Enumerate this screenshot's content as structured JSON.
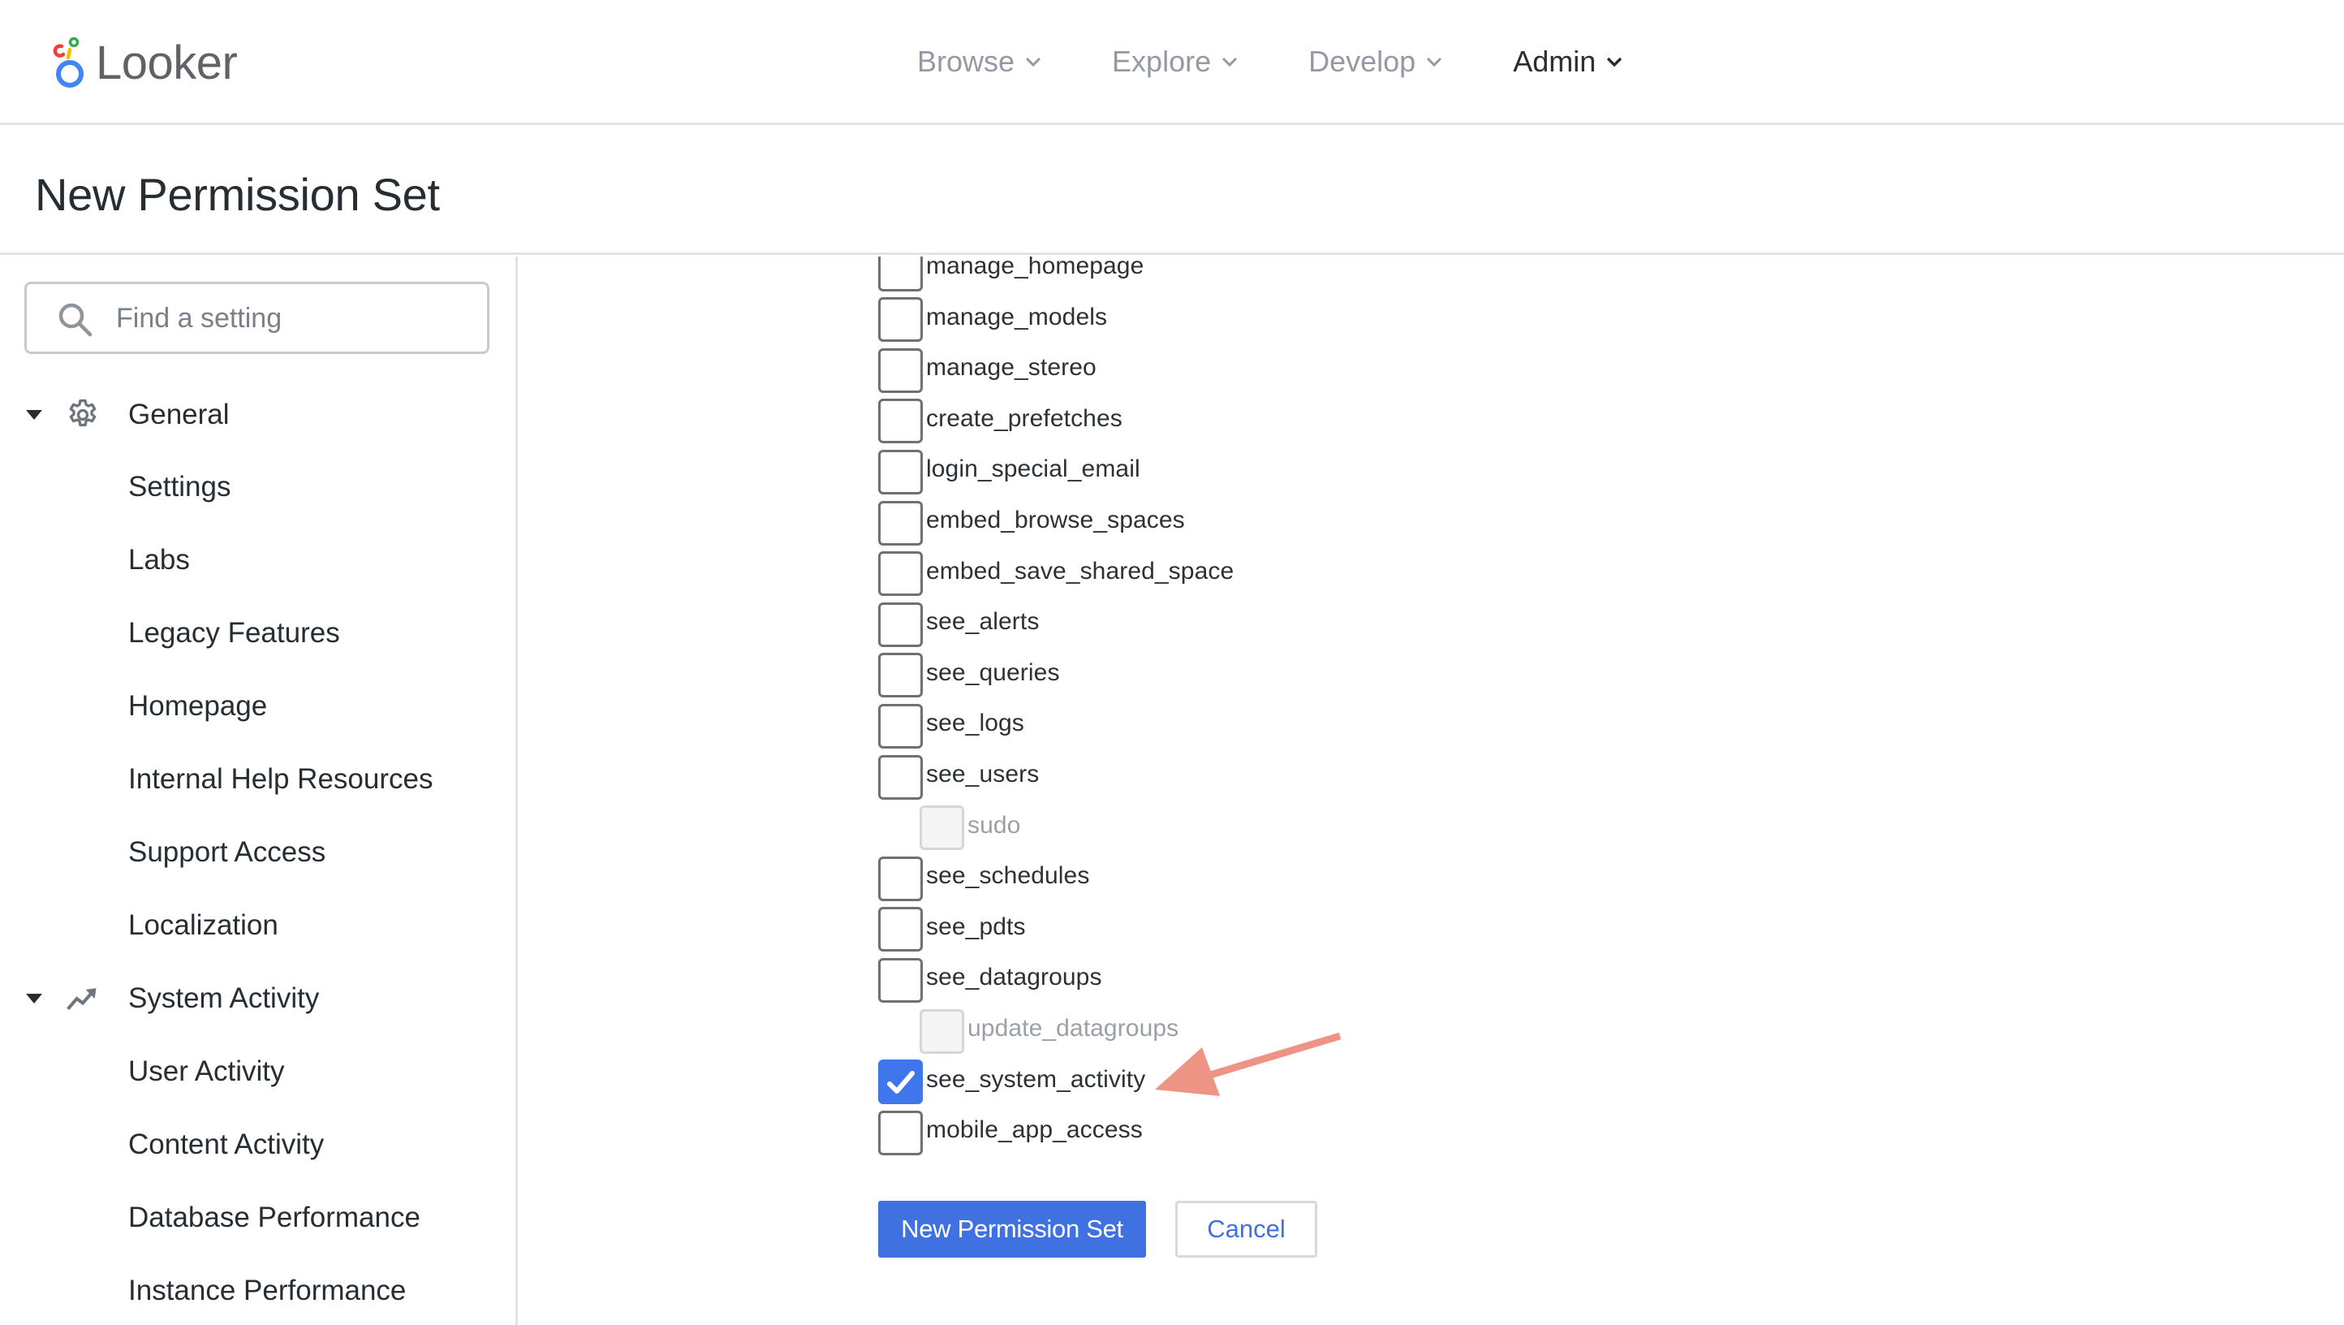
{
  "app": {
    "name": "Looker",
    "logo_colors": {
      "ring": "#4285f4",
      "red": "#ea4335",
      "yellow": "#fbbc04",
      "green": "#34a853"
    }
  },
  "topnav": {
    "items": [
      {
        "label": "Browse",
        "active": false
      },
      {
        "label": "Explore",
        "active": false
      },
      {
        "label": "Develop",
        "active": false
      },
      {
        "label": "Admin",
        "active": true
      }
    ]
  },
  "page": {
    "title": "New Permission Set"
  },
  "sidebar": {
    "search": {
      "placeholder": "Find a setting",
      "value": ""
    },
    "groups": [
      {
        "label": "General",
        "icon": "gear-icon",
        "expanded": true,
        "items": [
          "Settings",
          "Labs",
          "Legacy Features",
          "Homepage",
          "Internal Help Resources",
          "Support Access",
          "Localization"
        ]
      },
      {
        "label": "System Activity",
        "icon": "trending-up-icon",
        "expanded": true,
        "items": [
          "User Activity",
          "Content Activity",
          "Database Performance",
          "Instance Performance"
        ]
      }
    ]
  },
  "permissions": [
    {
      "name": "manage_homepage",
      "checked": false,
      "child": false,
      "disabled": false
    },
    {
      "name": "manage_models",
      "checked": false,
      "child": false,
      "disabled": false
    },
    {
      "name": "manage_stereo",
      "checked": false,
      "child": false,
      "disabled": false
    },
    {
      "name": "create_prefetches",
      "checked": false,
      "child": false,
      "disabled": false
    },
    {
      "name": "login_special_email",
      "checked": false,
      "child": false,
      "disabled": false
    },
    {
      "name": "embed_browse_spaces",
      "checked": false,
      "child": false,
      "disabled": false
    },
    {
      "name": "embed_save_shared_space",
      "checked": false,
      "child": false,
      "disabled": false
    },
    {
      "name": "see_alerts",
      "checked": false,
      "child": false,
      "disabled": false
    },
    {
      "name": "see_queries",
      "checked": false,
      "child": false,
      "disabled": false
    },
    {
      "name": "see_logs",
      "checked": false,
      "child": false,
      "disabled": false
    },
    {
      "name": "see_users",
      "checked": false,
      "child": false,
      "disabled": false
    },
    {
      "name": "sudo",
      "checked": false,
      "child": true,
      "disabled": true
    },
    {
      "name": "see_schedules",
      "checked": false,
      "child": false,
      "disabled": false
    },
    {
      "name": "see_pdts",
      "checked": false,
      "child": false,
      "disabled": false
    },
    {
      "name": "see_datagroups",
      "checked": false,
      "child": false,
      "disabled": false
    },
    {
      "name": "update_datagroups",
      "checked": false,
      "child": true,
      "disabled": true
    },
    {
      "name": "see_system_activity",
      "checked": true,
      "child": false,
      "disabled": false
    },
    {
      "name": "mobile_app_access",
      "checked": false,
      "child": false,
      "disabled": false
    }
  ],
  "actions": {
    "submit_label": "New Permission Set",
    "cancel_label": "Cancel"
  },
  "annotation": {
    "type": "arrow",
    "points_to": "see_system_activity",
    "color": "#ee9484"
  },
  "colors": {
    "accent": "#3f71e0",
    "checkbox_checked": "#3f76ec",
    "text": "#262d33",
    "muted_text": "#939aa3",
    "border": "#e2e3e6"
  }
}
